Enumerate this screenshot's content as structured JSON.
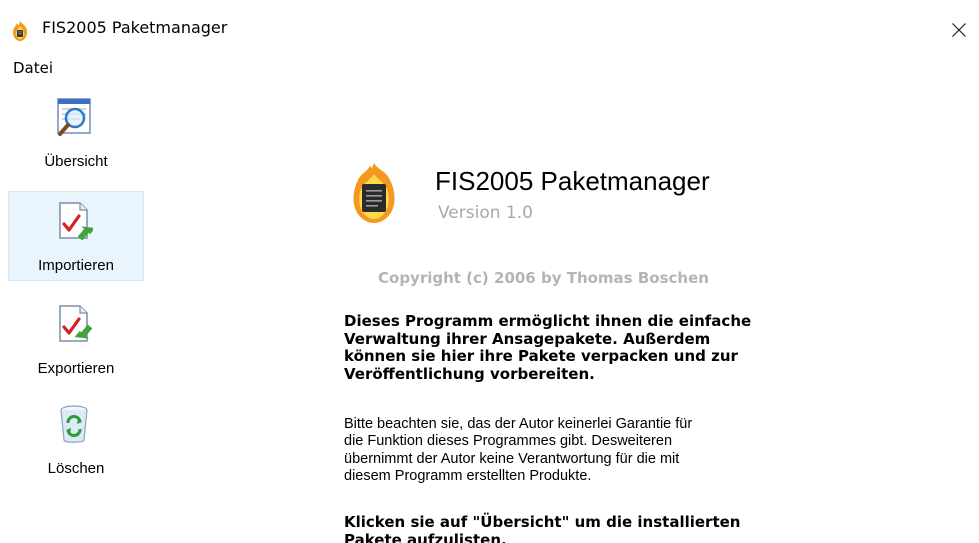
{
  "window": {
    "title": "FIS2005 Paketmanager",
    "close_glyph": "✕"
  },
  "menu": {
    "items": [
      {
        "label": "Datei"
      }
    ]
  },
  "sidebar": {
    "items": [
      {
        "label": "Übersicht",
        "icon": "overview-icon",
        "selected": false
      },
      {
        "label": "Importieren",
        "icon": "import-icon",
        "selected": true
      },
      {
        "label": "Exportieren",
        "icon": "export-icon",
        "selected": false
      },
      {
        "label": "Löschen",
        "icon": "delete-icon",
        "selected": false
      }
    ]
  },
  "main": {
    "title": "FIS2005 Paketmanager",
    "version": "Version 1.0",
    "copyright": "Copyright (c) 2006 by Thomas Boschen",
    "intro_lines": [
      "Dieses Programm ermöglicht ihnen die einfache",
      "Verwaltung ihrer Ansagepakete. Außerdem",
      "können sie hier ihre Pakete verpacken und zur",
      "Veröffentlichung vorbereiten."
    ],
    "disclaimer_lines": [
      "Bitte beachten sie, das der Autor keinerlei Garantie für",
      "die Funktion dieses Programmes gibt. Desweiteren",
      "übernimmt der Autor keine Verantwortung für die mit",
      "diesem Programm erstellten Produkte."
    ],
    "hint_lines": [
      "Klicken sie auf \"Übersicht\" um die installierten",
      "Pakete aufzulisten."
    ]
  },
  "colors": {
    "selected_bg": "#eaf4fd",
    "selected_border": "#d7e9f8",
    "version_gray": "#a8a8a8",
    "copyright_gray": "#b4b4b4",
    "flame_orange": "#f29a1f",
    "flame_yellow": "#ffd84a"
  }
}
